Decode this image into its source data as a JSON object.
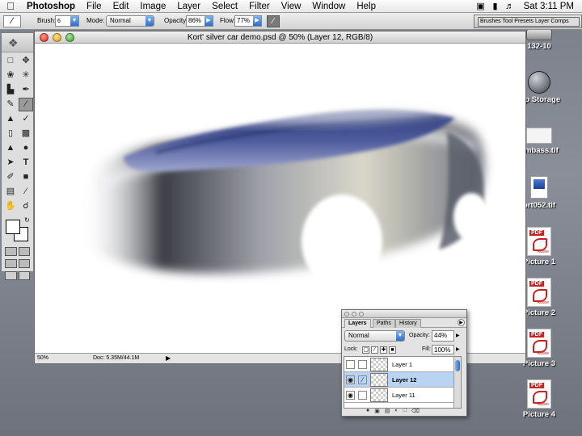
{
  "menubar": {
    "app": "Photoshop",
    "items": [
      "File",
      "Edit",
      "Image",
      "Layer",
      "Select",
      "Filter",
      "View",
      "Window",
      "Help"
    ],
    "clock": "Sat 3:11 PM"
  },
  "options": {
    "brush_label": "Brush:",
    "brush_size": "6",
    "mode_label": "Mode:",
    "mode_value": "Normal",
    "opacity_label": "Opacity:",
    "opacity_value": "86%",
    "flow_label": "Flow:",
    "flow_value": "77%"
  },
  "palette_well": "Brushes  Tool Presets  Layer Comps",
  "document": {
    "title": "Kort' silver car demo.psd @ 50% (Layer 12, RGB/8)",
    "zoom": "50%",
    "doc_size": "Doc: 5.35M/44.1M"
  },
  "desktop_icons": [
    {
      "label": "132-10",
      "kind": "disk"
    },
    {
      "label": "mp Storage",
      "kind": "network"
    },
    {
      "label": "umbass.tif",
      "kind": "image"
    },
    {
      "label": "ort052.tif",
      "kind": "tif"
    },
    {
      "label": "Picture 1",
      "kind": "pdf"
    },
    {
      "label": "Picture 2",
      "kind": "pdf"
    },
    {
      "label": "Picture 3",
      "kind": "pdf"
    },
    {
      "label": "Picture 4",
      "kind": "pdf"
    }
  ],
  "pdf_tag": "PDF",
  "pdf_small": "Adobe",
  "layers": {
    "tabs": [
      "Layers",
      "Paths",
      "History"
    ],
    "blend_mode": "Normal",
    "opacity_label": "Opacity:",
    "opacity_value": "44%",
    "lock_label": "Lock:",
    "fill_label": "Fill:",
    "fill_value": "100%",
    "items": [
      {
        "name": "Layer 1",
        "visible": false,
        "selected": false
      },
      {
        "name": "Layer 12",
        "visible": true,
        "selected": true
      },
      {
        "name": "Layer 11",
        "visible": true,
        "selected": false
      }
    ]
  }
}
